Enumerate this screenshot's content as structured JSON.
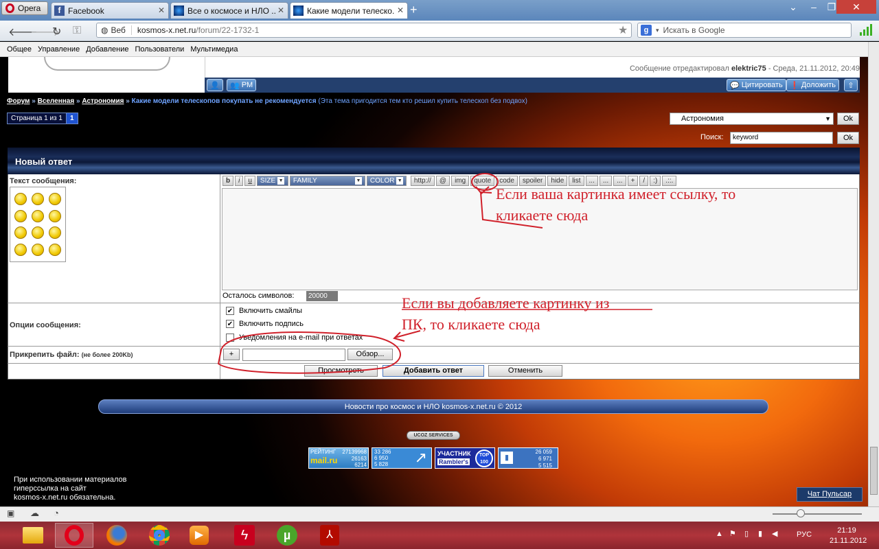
{
  "browser": {
    "menu_button": "Opera",
    "tabs": [
      {
        "label": "Facebook",
        "icon": "facebook-icon"
      },
      {
        "label": "Все о космосе и НЛО ...",
        "icon": "space-icon"
      },
      {
        "label": "Какие модели телеско...",
        "icon": "space-icon",
        "active": true
      }
    ],
    "address": {
      "scheme_label": "Веб",
      "host": "kosmos-x.net.ru",
      "path": "/forum/22-1732-1"
    },
    "search_placeholder": "Искать в Google",
    "menu": [
      "Общее",
      "Управление",
      "Добавление",
      "Пользователи",
      "Мультимедиа"
    ]
  },
  "post": {
    "edited_prefix": "Сообщение отредактировал",
    "editor": "elektric75",
    "edited_date": "- Среда, 21.11.2012, 20:49",
    "pm_label": "PM",
    "quote_label": "Цитировать",
    "report_label": "Доложить"
  },
  "breadcrumb": {
    "forum": "Форум",
    "universe": "Вселенная",
    "astronomy": "Астрономия",
    "topic": "Какие модели телескопов покупать не рекомендуется",
    "note": "(Эта тема пригодится тем кто решил купить телескоп без подвох)",
    "sep": "»"
  },
  "pager": {
    "text": "Страница 1 из 1",
    "current": "1"
  },
  "forum_select": {
    "selected": "Астрономия",
    "ok": "Ok"
  },
  "search": {
    "label": "Поиск:",
    "value": "keyword",
    "ok": "Ok"
  },
  "reply_form": {
    "title": "Новый ответ",
    "message_label": "Текст сообщения:",
    "toolbar": [
      "b",
      "i",
      "u"
    ],
    "size_label": "SIZE",
    "family_label": "FAMILY",
    "color_label": "COLOR",
    "toolbar2": [
      "http://",
      "@",
      "img",
      "quote",
      "code",
      "spoiler",
      "hide",
      "list",
      "...",
      "...",
      "...",
      "+",
      "/",
      ":)",
      ".::."
    ],
    "remaining_label": "Осталось символов:",
    "remaining_value": "20000",
    "options_label": "Опции сообщения:",
    "options": [
      {
        "label": "Включить смайлы",
        "checked": true
      },
      {
        "label": "Включить подпись",
        "checked": true
      },
      {
        "label": "Уведомления на e-mail при ответах",
        "checked": false
      }
    ],
    "attach_label": "Прикрепить файл:",
    "attach_note": "(не более 200Kb)",
    "attach_add": "+",
    "browse_label": "Обзор...",
    "preview_button": "Просмотреть",
    "submit_button": "Добавить ответ",
    "cancel_button": "Отменить"
  },
  "annotations": {
    "img_line1": "Если ваша картинка имеет ссылку, то",
    "img_line2": "кликаете сюда",
    "file_line1": "Если вы добавляете картинку из",
    "file_line2": "ПК, то кликаете сюда",
    "color": "#d0202a"
  },
  "footer": {
    "copyright": "Новости про космос и НЛО kosmos-x.net.ru © 2012",
    "ucoz": "UCOZ SERVICES",
    "counters": {
      "mail": {
        "label": "РЕЙТИНГ",
        "top": "27139968",
        "brand": "mail.ru",
        "mid": "26163",
        "low": "6214"
      },
      "liveinternet": {
        "a": "33 286",
        "b": "6 950",
        "c": "5 828"
      },
      "rambler": {
        "a": "УЧАСТНИК",
        "b": "Rambler's",
        "c": "TOP 100"
      },
      "stats": {
        "a": "26 059",
        "b": "6 971",
        "c": "5 515"
      }
    },
    "disclaimer": [
      "При использовании материалов",
      "гиперссылка на сайт",
      "kosmos-x.net.ru обязательна."
    ],
    "pulsar": "Чат Пульсар"
  },
  "taskbar": {
    "lang": "РУС",
    "time": "21:19",
    "date": "21.11.2012"
  }
}
